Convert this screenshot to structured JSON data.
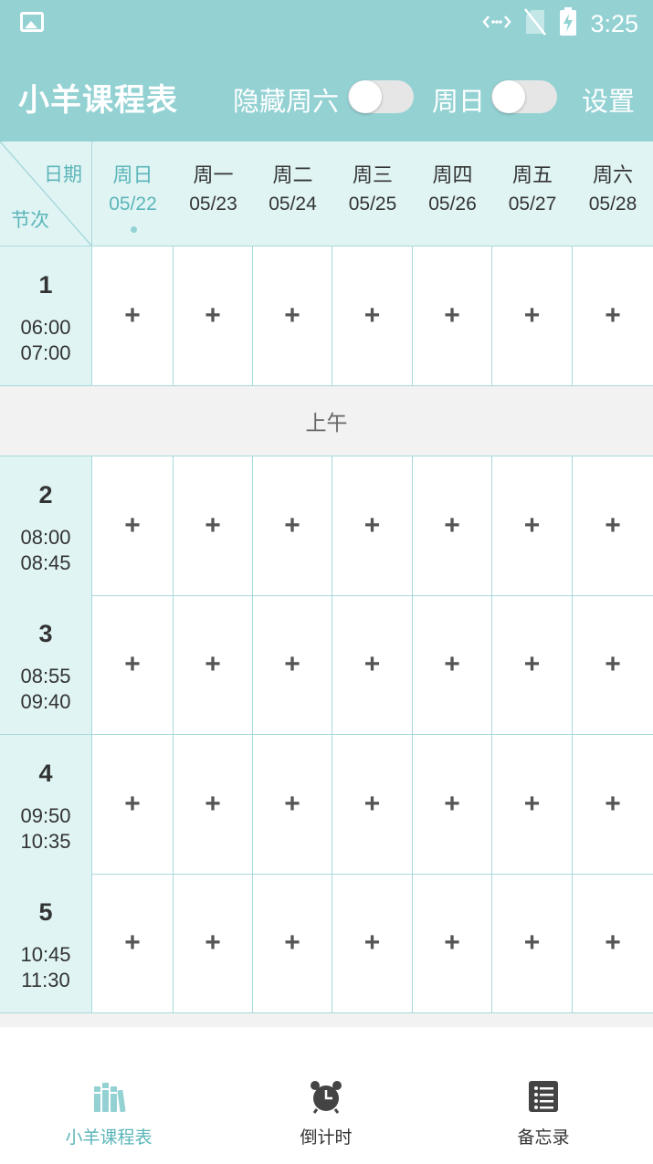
{
  "status_bar": {
    "time": "3:25",
    "icons": [
      "image-icon",
      "data-icon",
      "no-sim-icon",
      "battery-charging-icon"
    ]
  },
  "header": {
    "title": "小羊课程表",
    "hide_saturday_label": "隐藏周六",
    "hide_saturday_on": false,
    "sunday_label": "周日",
    "sunday_on": false,
    "settings_label": "设置",
    "background_color": "#93d1d3"
  },
  "grid": {
    "corner_date_label": "日期",
    "corner_period_label": "节次",
    "days": [
      {
        "name": "周日",
        "date": "05/22",
        "today": true
      },
      {
        "name": "周一",
        "date": "05/23",
        "today": false
      },
      {
        "name": "周二",
        "date": "05/24",
        "today": false
      },
      {
        "name": "周三",
        "date": "05/25",
        "today": false
      },
      {
        "name": "周四",
        "date": "05/26",
        "today": false
      },
      {
        "name": "周五",
        "date": "05/27",
        "today": false
      },
      {
        "name": "周六",
        "date": "05/28",
        "today": false
      }
    ],
    "add_symbol": "+",
    "periods": [
      {
        "num": "1",
        "start": "06:00",
        "end": "07:00"
      },
      {
        "num": "2",
        "start": "08:00",
        "end": "08:45"
      },
      {
        "num": "3",
        "start": "08:55",
        "end": "09:40"
      },
      {
        "num": "4",
        "start": "09:50",
        "end": "10:35"
      },
      {
        "num": "5",
        "start": "10:45",
        "end": "11:30"
      }
    ],
    "section_label": "上午",
    "accent_color": "#5bb5b9"
  },
  "bottom_nav": {
    "items": [
      {
        "label": "小羊课程表",
        "icon": "books-icon",
        "active": true
      },
      {
        "label": "倒计时",
        "icon": "alarm-clock-icon",
        "active": false
      },
      {
        "label": "备忘录",
        "icon": "notes-list-icon",
        "active": false
      }
    ]
  }
}
